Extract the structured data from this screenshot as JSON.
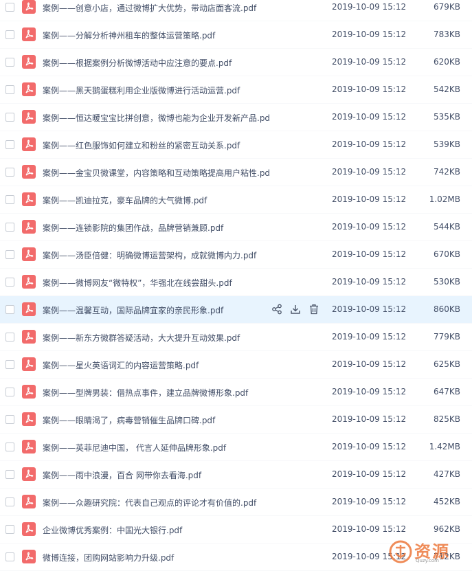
{
  "colors": {
    "accent_pdf": "#f26b6b",
    "hover_row": "#e8f4fe",
    "text": "#424e67"
  },
  "hover_actions": [
    "share-icon",
    "download-icon",
    "delete-icon"
  ],
  "files": [
    {
      "name": "案例——创意小店，通过微博扩大优势，带动店面客流.pdf",
      "time": "2019-10-09 15:12",
      "size": "679KB"
    },
    {
      "name": "案例——分解分析神州租车的整体运营策略.pdf",
      "time": "2019-10-09 15:12",
      "size": "783KB"
    },
    {
      "name": "案例——根据案例分析微博活动中应注意的要点.pdf",
      "time": "2019-10-09 15:12",
      "size": "620KB"
    },
    {
      "name": "案例——黑天鹅蛋糕利用企业版微博进行活动运营.pdf",
      "time": "2019-10-09 15:12",
      "size": "542KB"
    },
    {
      "name": "案例——恒达暖宝宝比拼创意，微博也能为企业开发新产品.pdf",
      "time": "2019-10-09 15:12",
      "size": "535KB"
    },
    {
      "name": "案例——红色服饰如何建立和粉丝的紧密互动关系.pdf",
      "time": "2019-10-09 15:12",
      "size": "539KB"
    },
    {
      "name": "案例——金宝贝微课堂，内容策略和互动策略提高用户粘性.pdf",
      "time": "2019-10-09 15:12",
      "size": "742KB"
    },
    {
      "name": "案例——凯迪拉克，豪车品牌的大气微博.pdf",
      "time": "2019-10-09 15:12",
      "size": "1.02MB"
    },
    {
      "name": "案例——连锁影院的集团作战，品牌营销兼顾.pdf",
      "time": "2019-10-09 15:12",
      "size": "544KB"
    },
    {
      "name": "案例——汤臣倍健：明确微博运营架构，成就微博内力.pdf",
      "time": "2019-10-09 15:12",
      "size": "670KB"
    },
    {
      "name": "案例——微博网友“微特权”，华强北在线尝甜头.pdf",
      "time": "2019-10-09 15:12",
      "size": "530KB"
    },
    {
      "name": "案例——温馨互动，国际品牌宜家的亲民形象.pdf",
      "time": "2019-10-09 15:12",
      "size": "860KB",
      "hover": true
    },
    {
      "name": "案例——新东方微群答疑活动，大大提升互动效果.pdf",
      "time": "2019-10-09 15:12",
      "size": "779KB"
    },
    {
      "name": "案例——星火英语词汇的内容运营策略.pdf",
      "time": "2019-10-09 15:12",
      "size": "625KB"
    },
    {
      "name": "案例——型牌男装：借热点事件，建立品牌微博形象.pdf",
      "time": "2019-10-09 15:12",
      "size": "647KB"
    },
    {
      "name": "案例——眼睛渴了，病毒营销催生品牌口碑.pdf",
      "time": "2019-10-09 15:12",
      "size": "825KB"
    },
    {
      "name": "案例——英菲尼迪中国， 代言人延伸品牌形象.pdf",
      "time": "2019-10-09 15:12",
      "size": "1.42MB"
    },
    {
      "name": "案例——雨中浪漫，百合 网带你去看海.pdf",
      "time": "2019-10-09 15:12",
      "size": "427KB"
    },
    {
      "name": "案例——众趣研究院：代表自己观点的评论才有价值的.pdf",
      "time": "2019-10-09 15:12",
      "size": "452KB"
    },
    {
      "name": "企业微博优秀案例：中国光大银行.pdf",
      "time": "2019-10-09 15:12",
      "size": "962KB"
    },
    {
      "name": "微博连接，团购网站影响力升级.pdf",
      "time": "2019-10-09 15:12",
      "size": "712KB"
    }
  ],
  "watermark": {
    "text": "资源",
    "url": "Quzy.com"
  }
}
